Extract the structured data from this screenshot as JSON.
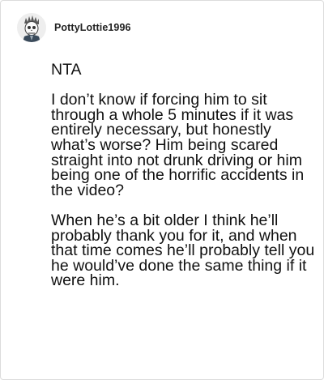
{
  "post": {
    "username": "PottyLottie1996",
    "avatar_icon": "ghost-rider-avatar-icon",
    "paragraphs": [
      "NTA",
      "I don’t know if forcing him to sit through a whole 5 minutes if it was entirely necessary, but honestly what’s worse? Him being scared straight into not drunk driving or him being one of the horrific accidents in the video?",
      "When he’s a bit older I think he’ll probably thank you for it, and when that time comes he’ll probably tell you he would’ve done the same thing if it were him."
    ]
  },
  "colors": {
    "border": "#dcdcdc",
    "text": "#111111",
    "username": "#222222"
  }
}
